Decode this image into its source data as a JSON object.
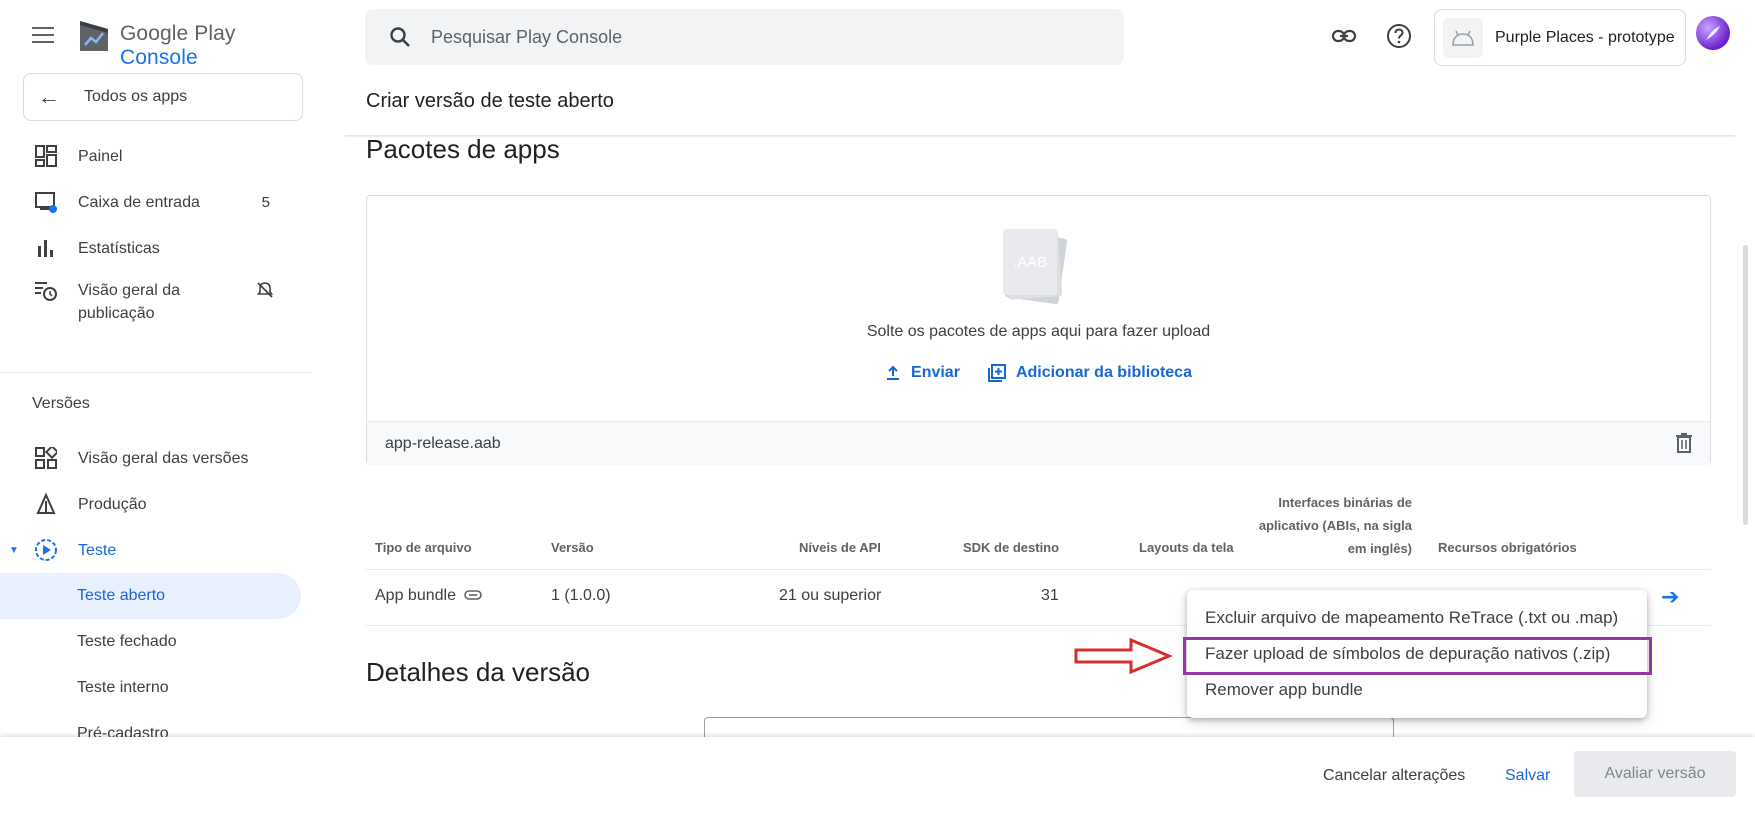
{
  "brand": {
    "google_play": "Google Play",
    "console": "Console"
  },
  "sidebar": {
    "all_apps": "Todos os apps",
    "items": [
      {
        "label": "Painel",
        "icon": "dashboard-icon"
      },
      {
        "label": "Caixa de entrada",
        "icon": "inbox-icon",
        "badge": "5"
      },
      {
        "label": "Estatísticas",
        "icon": "bar-chart-icon"
      },
      {
        "label": "Visão geral da publicação",
        "icon": "publishing-overview-icon"
      }
    ],
    "section_label": "Versões",
    "release_items": [
      {
        "label": "Visão geral das versões",
        "icon": "releases-overview-icon"
      },
      {
        "label": "Produção",
        "icon": "production-icon"
      },
      {
        "label": "Teste",
        "icon": "testing-icon"
      }
    ],
    "sub_items": [
      {
        "label": "Teste aberto",
        "active": true
      },
      {
        "label": "Teste fechado"
      },
      {
        "label": "Teste interno"
      },
      {
        "label": "Pré-cadastro"
      }
    ]
  },
  "search": {
    "placeholder": "Pesquisar Play Console"
  },
  "app_chip": {
    "name": "Purple Places - prototype"
  },
  "page": {
    "subtitle": "Criar versão de teste aberto",
    "bundles_title": "Pacotes de apps",
    "aab_label": ".AAB",
    "drop_text": "Solte os pacotes de apps aqui para fazer upload",
    "upload_label": "Enviar",
    "library_label": "Adicionar da biblioteca",
    "file_name": "app-release.aab",
    "details_title": "Detalhes da versão"
  },
  "table": {
    "headers": {
      "file_type": "Tipo de arquivo",
      "version": "Versão",
      "api_levels": "Níveis de API",
      "target_sdk": "SDK de destino",
      "screen_layouts": "Layouts da tela",
      "abis_line1": "Interfaces binárias de",
      "abis_line2": "aplicativo (ABIs, na sigla",
      "abis_line3": "em inglês)",
      "required_features": "Recursos obrigatórios"
    },
    "row": {
      "file_type": "App bundle",
      "version": "1 (1.0.0)",
      "api_levels": "21 ou superior",
      "target_sdk": "31"
    }
  },
  "menu": {
    "items": [
      "Excluir arquivo de mapeamento ReTrace (.txt ou .map)",
      "Fazer upload de símbolos de depuração nativos (.zip)",
      "Remover app bundle"
    ]
  },
  "footer": {
    "cancel": "Cancelar alterações",
    "save": "Salvar",
    "review": "Avaliar versão"
  },
  "colors": {
    "accent": "#1a73e8",
    "highlight_box": "#8e3aa3",
    "annotation_arrow": "#d32f2f",
    "active_bg": "#e8f0fe"
  }
}
